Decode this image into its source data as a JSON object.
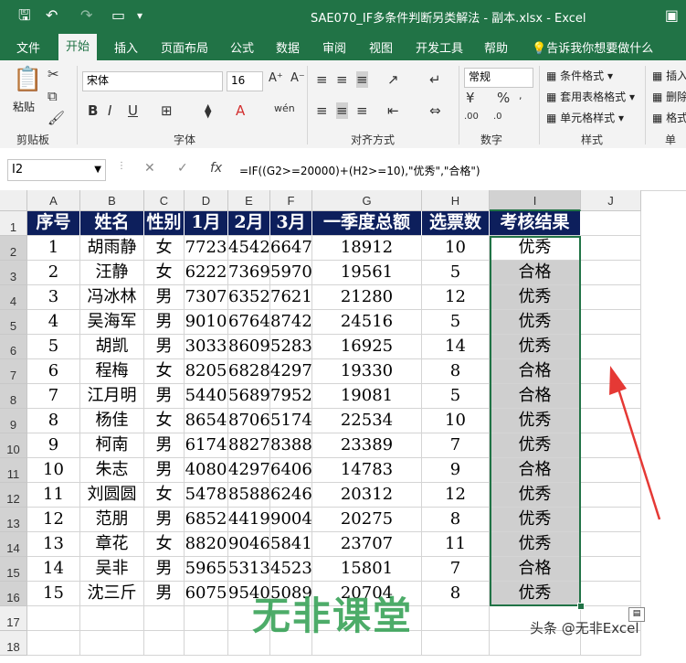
{
  "titlebar": {
    "title": "SAE070_IF多条件判断另类解法 - 副本.xlsx  -  Excel"
  },
  "tabs": [
    "文件",
    "开始",
    "插入",
    "页面布局",
    "公式",
    "数据",
    "审阅",
    "视图",
    "开发工具",
    "帮助",
    "告诉我你想要做什么"
  ],
  "ribbon": {
    "paste": "粘贴",
    "clipboard": "剪贴板",
    "font_name": "宋体",
    "font_size": "16",
    "font_group": "字体",
    "align_group": "对齐方式",
    "number_format": "常规",
    "number_group": "数字",
    "cond_format": "条件格式",
    "table_format": "套用表格格式",
    "cell_style": "单元格样式",
    "style_group": "样式",
    "insert": "插入",
    "delete": "删除",
    "format": "格式",
    "cells_group": "单元"
  },
  "formula_bar": {
    "name_box": "I2",
    "fx": "fx",
    "formula": "=IF((G2>=20000)+(H2>=10),\"优秀\",\"合格\")"
  },
  "columns": [
    "A",
    "B",
    "C",
    "D",
    "E",
    "F",
    "G",
    "H",
    "I",
    "J"
  ],
  "rows": [
    "1",
    "2",
    "3",
    "4",
    "5",
    "6",
    "7",
    "8",
    "9",
    "10",
    "11",
    "12",
    "13",
    "14",
    "15",
    "16",
    "17",
    "18"
  ],
  "headers": [
    "序号",
    "姓名",
    "性别",
    "1月",
    "2月",
    "3月",
    "一季度总额",
    "选票数",
    "考核结果"
  ],
  "data": [
    [
      "1",
      "胡雨静",
      "女",
      "7723",
      "4542",
      "6647",
      "18912",
      "10",
      "优秀"
    ],
    [
      "2",
      "汪静",
      "女",
      "6222",
      "7369",
      "5970",
      "19561",
      "5",
      "合格"
    ],
    [
      "3",
      "冯冰林",
      "男",
      "7307",
      "6352",
      "7621",
      "21280",
      "12",
      "优秀"
    ],
    [
      "4",
      "吴海军",
      "男",
      "9010",
      "6764",
      "8742",
      "24516",
      "5",
      "优秀"
    ],
    [
      "5",
      "胡凯",
      "男",
      "3033",
      "8609",
      "5283",
      "16925",
      "14",
      "优秀"
    ],
    [
      "6",
      "程梅",
      "女",
      "8205",
      "6828",
      "4297",
      "19330",
      "8",
      "合格"
    ],
    [
      "7",
      "江月明",
      "男",
      "5440",
      "5689",
      "7952",
      "19081",
      "5",
      "合格"
    ],
    [
      "8",
      "杨佳",
      "女",
      "8654",
      "8706",
      "5174",
      "22534",
      "10",
      "优秀"
    ],
    [
      "9",
      "柯南",
      "男",
      "6174",
      "8827",
      "8388",
      "23389",
      "7",
      "优秀"
    ],
    [
      "10",
      "朱志",
      "男",
      "4080",
      "4297",
      "6406",
      "14783",
      "9",
      "合格"
    ],
    [
      "11",
      "刘圆圆",
      "女",
      "5478",
      "8588",
      "6246",
      "20312",
      "12",
      "优秀"
    ],
    [
      "12",
      "范朋",
      "男",
      "6852",
      "4419",
      "9004",
      "20275",
      "8",
      "优秀"
    ],
    [
      "13",
      "章花",
      "女",
      "8820",
      "9046",
      "5841",
      "23707",
      "11",
      "优秀"
    ],
    [
      "14",
      "吴非",
      "男",
      "5965",
      "5313",
      "4523",
      "15801",
      "7",
      "合格"
    ],
    [
      "15",
      "沈三斤",
      "男",
      "6075",
      "9540",
      "5089",
      "20704",
      "8",
      "优秀"
    ]
  ],
  "watermark": "无非课堂",
  "credit": "头条 @无非Excel",
  "colors": {
    "accent": "#217346",
    "header_bg": "#0d1f5c",
    "arrow": "#e53935"
  }
}
